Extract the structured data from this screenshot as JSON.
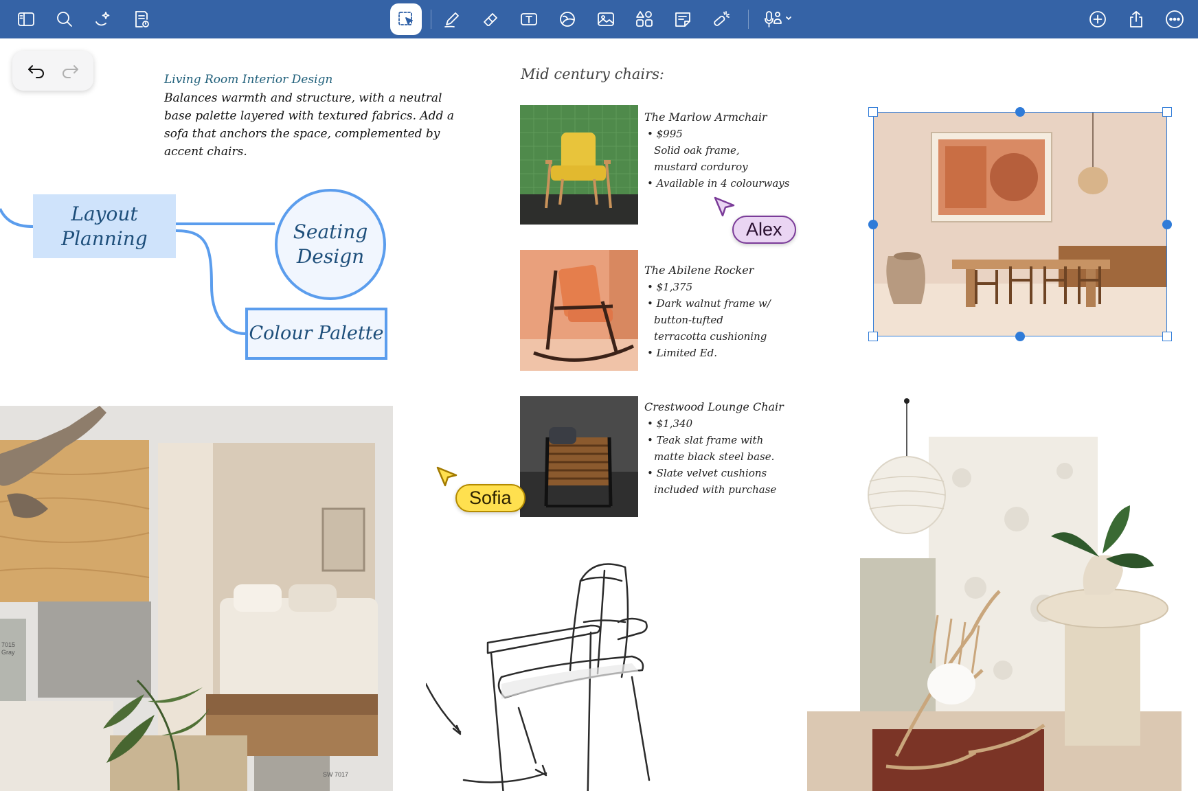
{
  "toolbar": {
    "left_tools": [
      {
        "name": "sidebar-toggle-button",
        "icon": "sidebar-icon"
      },
      {
        "name": "search-button",
        "icon": "search-icon"
      },
      {
        "name": "ai-assist-button",
        "icon": "sparkle-icon"
      },
      {
        "name": "page-notes-button",
        "icon": "document-icon"
      }
    ],
    "center_tools": [
      {
        "name": "lasso-select-tool",
        "icon": "lasso-select-icon",
        "active": true
      },
      {
        "name": "pen-tool",
        "icon": "pen-icon"
      },
      {
        "name": "eraser-tool",
        "icon": "eraser-icon"
      },
      {
        "name": "text-tool",
        "icon": "text-box-icon"
      },
      {
        "name": "shapes-tool",
        "icon": "shapes-icon"
      },
      {
        "name": "image-tool",
        "icon": "image-icon"
      },
      {
        "name": "elements-tool",
        "icon": "elements-icon"
      },
      {
        "name": "sticky-note-tool",
        "icon": "sticky-note-icon"
      },
      {
        "name": "laser-pointer-tool",
        "icon": "laser-pointer-icon"
      },
      {
        "name": "audio-record-tool",
        "icon": "microphone-icon"
      }
    ],
    "right_tools": [
      {
        "name": "add-page-button",
        "icon": "plus-circle-icon"
      },
      {
        "name": "share-button",
        "icon": "share-icon"
      },
      {
        "name": "more-button",
        "icon": "more-icon"
      }
    ],
    "accent": "#3563a6"
  },
  "note": {
    "title": "Living Room Interior Design",
    "body": "Balances warmth and structure, with a neutral base palette layered with textured fabrics. Add a sofa that anchors the space, complemented by accent chairs."
  },
  "mindmap": {
    "layout": "Layout Planning",
    "seating": "Seating Design",
    "colour": "Colour Palette"
  },
  "chairs": {
    "heading": "Mid century chairs:",
    "items": [
      {
        "name": "The Marlow Armchair",
        "price": "$995",
        "details": [
          "Solid oak frame,",
          "mustard corduroy"
        ],
        "extra": "Available in 4 colourways"
      },
      {
        "name": "The Abilene Rocker",
        "price": "$1,375",
        "details": [
          "Dark walnut frame w/",
          "button-tufted",
          "terracotta cushioning"
        ],
        "extra": "Limited Ed."
      },
      {
        "name": "Crestwood Lounge Chair",
        "price": "$1,340",
        "details": [
          "Teak slat frame with",
          "matte black steel base."
        ],
        "extra_lines": [
          "Slate velvet cushions",
          "included with purchase"
        ]
      }
    ]
  },
  "collaborators": {
    "alex": {
      "name": "Alex",
      "color": "#7a3b98"
    },
    "sofia": {
      "name": "Sofia",
      "color": "#ffe04f"
    }
  },
  "swatches": {
    "left": "7015\nGray",
    "bottom": "SW 7017"
  }
}
